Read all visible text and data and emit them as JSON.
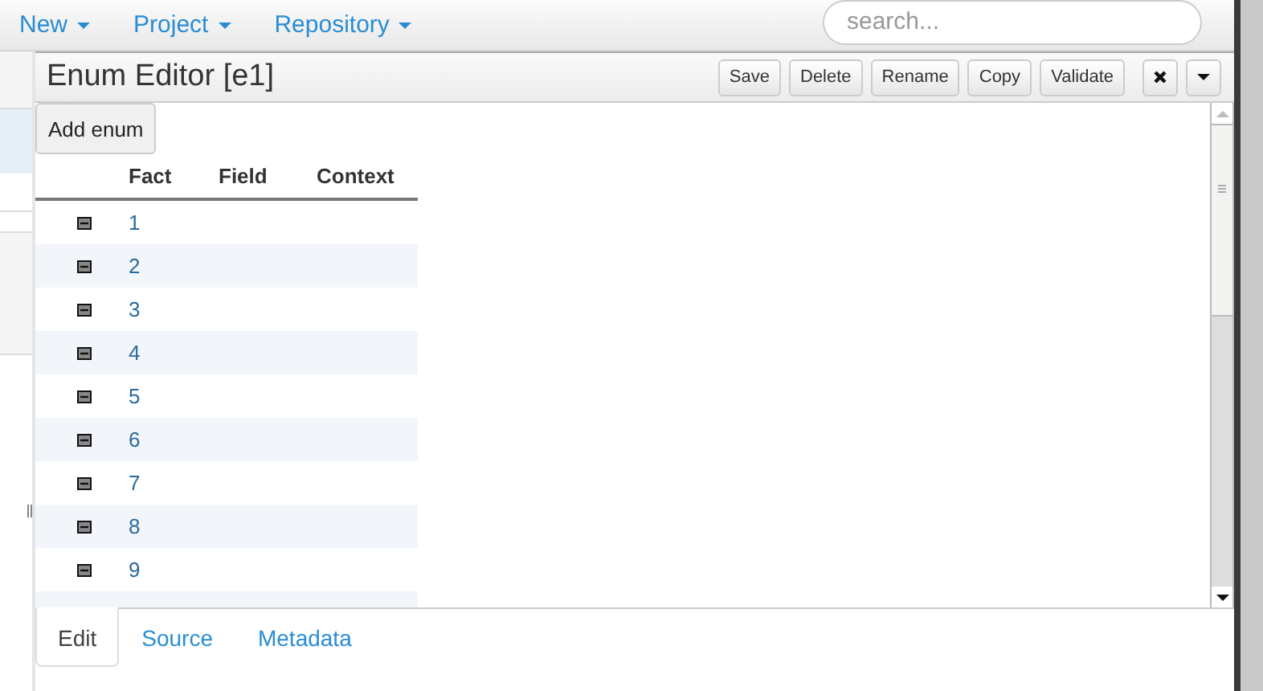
{
  "navbar": {
    "menus": [
      "New",
      "Project",
      "Repository"
    ],
    "search": {
      "placeholder": "search..."
    }
  },
  "editor": {
    "title": "Enum Editor [e1]",
    "buttons": [
      "Save",
      "Delete",
      "Rename",
      "Copy",
      "Validate"
    ],
    "add_button": "Add enum",
    "table": {
      "columns": [
        "Fact",
        "Field",
        "Context"
      ],
      "rows": [
        {
          "fact": "1"
        },
        {
          "fact": "2"
        },
        {
          "fact": "3"
        },
        {
          "fact": "4"
        },
        {
          "fact": "5"
        },
        {
          "fact": "6"
        },
        {
          "fact": "7"
        },
        {
          "fact": "8"
        },
        {
          "fact": "9"
        }
      ]
    },
    "tabs": [
      {
        "label": "Edit",
        "selected": true
      },
      {
        "label": "Source",
        "selected": false
      },
      {
        "label": "Metadata",
        "selected": false
      }
    ]
  }
}
